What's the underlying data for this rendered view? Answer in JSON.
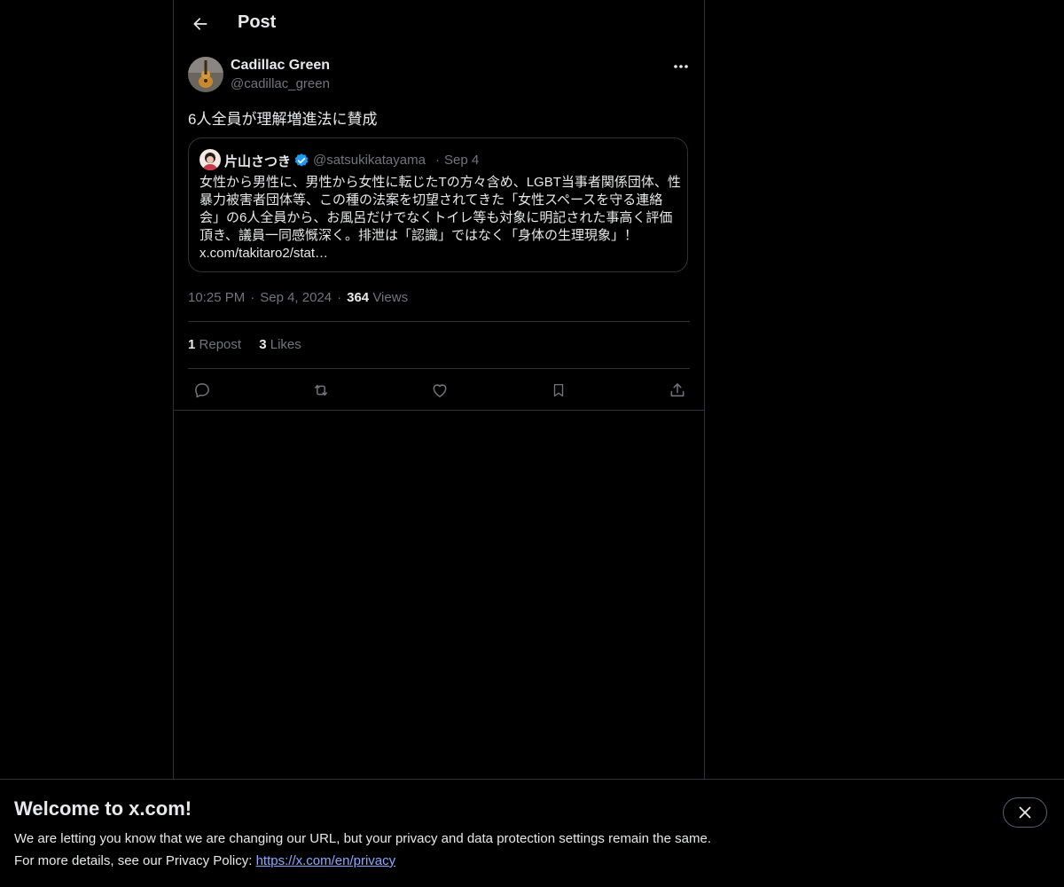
{
  "header": {
    "title": "Post",
    "back_icon": "arrow-left-icon"
  },
  "post": {
    "author_name": "Cadillac Green",
    "author_handle": "@cadillac_green",
    "text": "6人全員が理解増進法に賛成",
    "quote": {
      "author_name": "片山さつき",
      "author_handle": "@satsukikatayama",
      "separator": "·",
      "date": "Sep 4",
      "body": "女性から男性に、男性から女性に転じたTの方々含め、LGBT当事者関係団体、性暴力被害者団体等、この種の法案を切望されてきた「女性スペースを守る連絡会」の6人全員から、お風呂だけでなくトイレ等も対象に明記された事高く評価頂き、議員一同感慨深く。排泄は「認識」ではなく「身体の生理現象」！ x.com/takitaro2/stat…"
    },
    "time": "10:25 PM",
    "separator": "·",
    "date": "Sep 4, 2024",
    "views_count": "364",
    "views_label": "Views",
    "reposts_count": "1",
    "reposts_label": "Repost",
    "likes_count": "3",
    "likes_label": "Likes"
  },
  "banner": {
    "title": "Welcome to x.com!",
    "line1": "We are letting you know that we are changing our URL, but your privacy and data protection settings remain the same.",
    "line2_prefix": "For more details, see our Privacy Policy: ",
    "link": "https://x.com/en/privacy"
  },
  "colors": {
    "background": "#000000",
    "text": "#e7e9ea",
    "muted": "#71767b",
    "border": "#2f3336",
    "verified": "#1d9bf0",
    "link": "#8fa8ff"
  }
}
